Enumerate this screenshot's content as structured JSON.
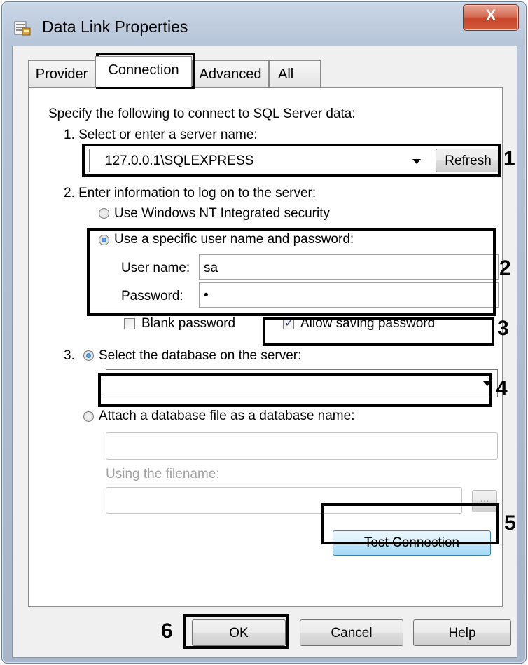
{
  "window": {
    "title": "Data Link Properties",
    "close_symbol": "X"
  },
  "tabs": [
    {
      "label": "Provider",
      "active": false
    },
    {
      "label": "Connection",
      "active": true
    },
    {
      "label": "Advanced",
      "active": false
    },
    {
      "label": "All",
      "active": false
    }
  ],
  "connection": {
    "intro": "Specify the following to connect to SQL Server data:",
    "step1": "1. Select or enter a server name:",
    "server_value": "127.0.0.1\\SQLEXPRESS",
    "refresh_label": "Refresh",
    "step2": "2. Enter information to log on to the server:",
    "windows_nt_label": "Use Windows NT Integrated security",
    "specific_label": "Use a specific user name and password:",
    "username_label": "User name:",
    "username_value": "sa",
    "password_label": "Password:",
    "password_value": "•",
    "blank_password_label": "Blank password",
    "blank_password_checked": false,
    "allow_saving_label": "Allow saving password",
    "allow_saving_checked": true,
    "step3": "3.",
    "select_db_label": "Select the database on the server:",
    "database_value": "",
    "attach_label": "Attach a database file as a database name:",
    "using_filename_label": "Using the filename:",
    "browse_label": "...",
    "test_connection_label": "Test Connection"
  },
  "footer": {
    "ok_label": "OK",
    "cancel_label": "Cancel",
    "help_label": "Help"
  },
  "annotations": [
    "1",
    "2",
    "3",
    "4",
    "5",
    "6"
  ]
}
